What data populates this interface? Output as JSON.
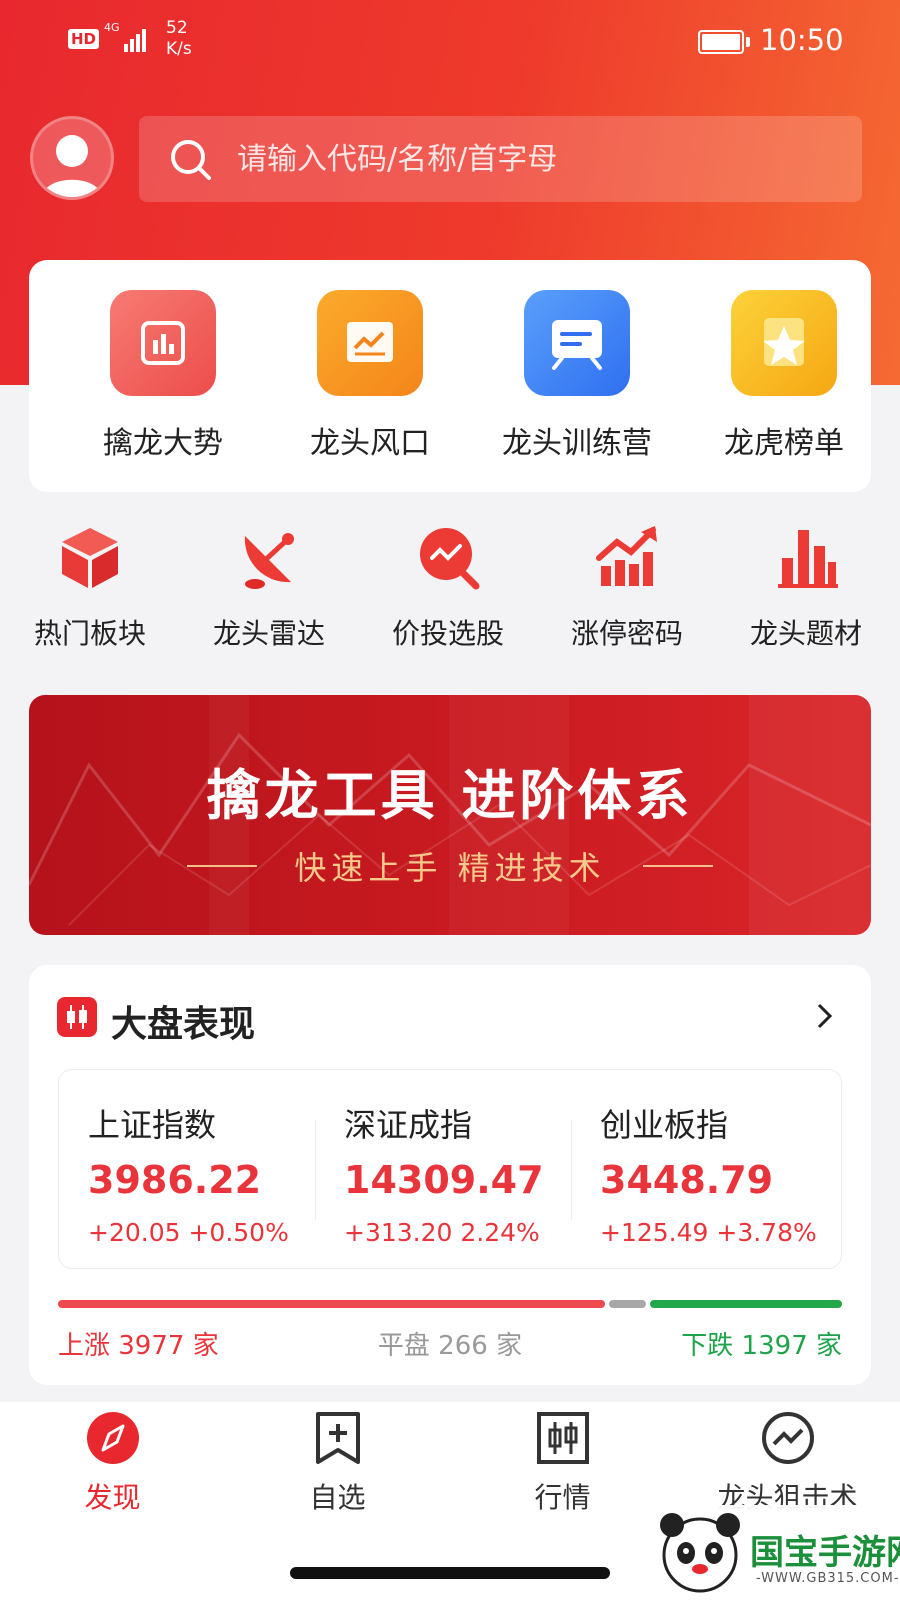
{
  "status_bar": {
    "hd": "HD",
    "network": "4G",
    "speed_value": "52",
    "speed_unit": "K/s",
    "time": "10:50"
  },
  "search": {
    "placeholder": "请输入代码/名称/首字母"
  },
  "features": [
    {
      "label": "擒龙大势",
      "icon": "bar-chart-icon",
      "color": "#f0605a"
    },
    {
      "label": "龙头风口",
      "icon": "line-chart-icon",
      "color": "#f59a1e"
    },
    {
      "label": "龙头训练营",
      "icon": "board-icon",
      "color": "#3d86f2"
    },
    {
      "label": "龙虎榜单",
      "icon": "star-badge-icon",
      "color": "#f8b820"
    }
  ],
  "tools": [
    {
      "label": "热门板块",
      "icon": "cube-icon"
    },
    {
      "label": "龙头雷达",
      "icon": "radar-dish-icon"
    },
    {
      "label": "价投选股",
      "icon": "magnifier-chart-icon"
    },
    {
      "label": "涨停密码",
      "icon": "rising-chart-icon"
    },
    {
      "label": "龙头题材",
      "icon": "bars-icon"
    }
  ],
  "banner": {
    "title": "擒龙工具  进阶体系",
    "subtitle": "快速上手 精进技术"
  },
  "market": {
    "title": "大盘表现",
    "indices": [
      {
        "name": "上证指数",
        "value": "3986.22",
        "change": "+20.05  +0.50%"
      },
      {
        "name": "深证成指",
        "value": "14309.47",
        "change": "+313.20  2.24%"
      },
      {
        "name": "创业板指",
        "value": "3448.79",
        "change": "+125.49 +3.78%"
      }
    ],
    "breadth": {
      "up_count": 3977,
      "flat_count": 266,
      "down_count": 1397,
      "up_text": "上涨 3977 家",
      "flat_text": "平盘 266 家",
      "down_text": "下跌 1397 家",
      "up_color": "#ee4a4f",
      "flat_color": "#a8a8a8",
      "down_color": "#22a84a"
    }
  },
  "nav": [
    {
      "label": "发现",
      "icon": "compass-icon",
      "active": true
    },
    {
      "label": "自选",
      "icon": "bookmark-plus-icon",
      "active": false
    },
    {
      "label": "行情",
      "icon": "candlestick-icon",
      "active": false
    },
    {
      "label": "龙头狙击术",
      "icon": "trend-circle-icon",
      "active": false
    }
  ],
  "watermark": {
    "text": "国宝手游网",
    "url": "-WWW.GB315.COM-"
  },
  "colors": {
    "brand_red": "#e8282e",
    "brand_orange": "#f56a33",
    "up_red": "#e8343a",
    "down_green": "#1fa34a"
  }
}
